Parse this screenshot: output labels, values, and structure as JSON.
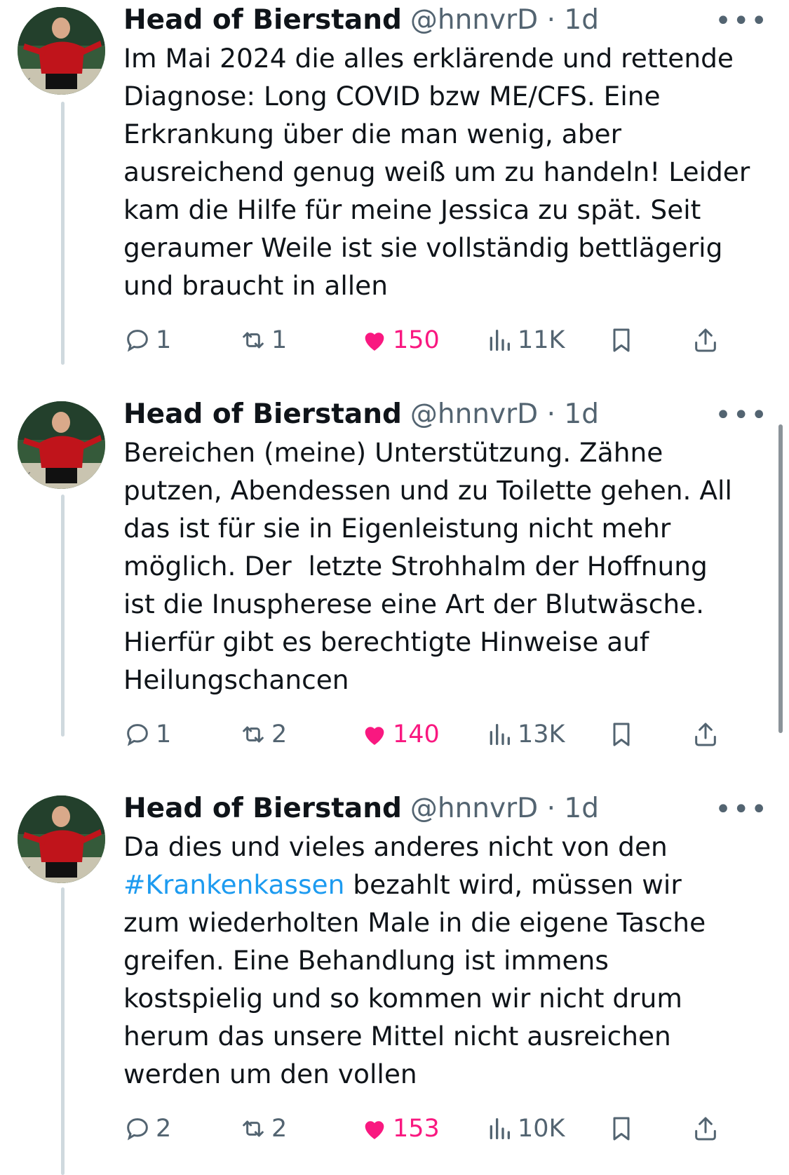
{
  "tweets": [
    {
      "name": "Head of Bierstand",
      "handle": "@hnnvrD",
      "time": "· 1d",
      "more": "•••",
      "lines": [
        "Im Mai 2024 die alles erklärende und rettende",
        "Diagnose: Long COVID bzw ME/CFS. Eine",
        "Erkrankung über die man wenig, aber",
        "ausreichend genug weiß um zu handeln! Leider",
        "kam die Hilfe für meine Jessica zu spät. Seit",
        "geraumer Weile ist sie vollständig bettlägerig",
        "und braucht in allen"
      ],
      "replies": "1",
      "reposts": "1",
      "likes": "150",
      "views": "11K"
    },
    {
      "name": "Head of Bierstand",
      "handle": "@hnnvrD",
      "time": "· 1d",
      "more": "•••",
      "lines": [
        "Bereichen (meine) Unterstützung. Zähne",
        "putzen, Abendessen und zu Toilette gehen. All",
        "das ist für sie in Eigenleistung nicht mehr",
        "möglich. Der  letzte Strohhalm der Hoffnung",
        "ist die Inuspherese eine Art der Blutwäsche.",
        "Hierfür gibt es berechtigte Hinweise auf",
        "Heilungschancen"
      ],
      "replies": "1",
      "reposts": "2",
      "likes": "140",
      "views": "13K"
    },
    {
      "name": "Head of Bierstand",
      "handle": "@hnnvrD",
      "time": "· 1d",
      "more": "•••",
      "lines": [
        "Da dies und vieles anderes nicht von den",
        "",
        "zum wiederholten Male in die eigene Tasche",
        "greifen. Eine Behandlung ist immens",
        "kostspielig und so kommen wir nicht drum",
        "herum das unsere Mittel nicht ausreichen",
        "werden um den vollen"
      ],
      "hashtag": "#Krankenkassen",
      "line2_rest": " bezahlt wird, müssen wir",
      "replies": "2",
      "reposts": "2",
      "likes": "153",
      "views": "10K"
    }
  ],
  "colors": {
    "like": "#f91880",
    "hashtag": "#1d9bf0",
    "muted": "#536471"
  },
  "icons": [
    "reply-icon",
    "repost-icon",
    "heart-icon",
    "views-icon",
    "bookmark-icon",
    "share-icon"
  ]
}
